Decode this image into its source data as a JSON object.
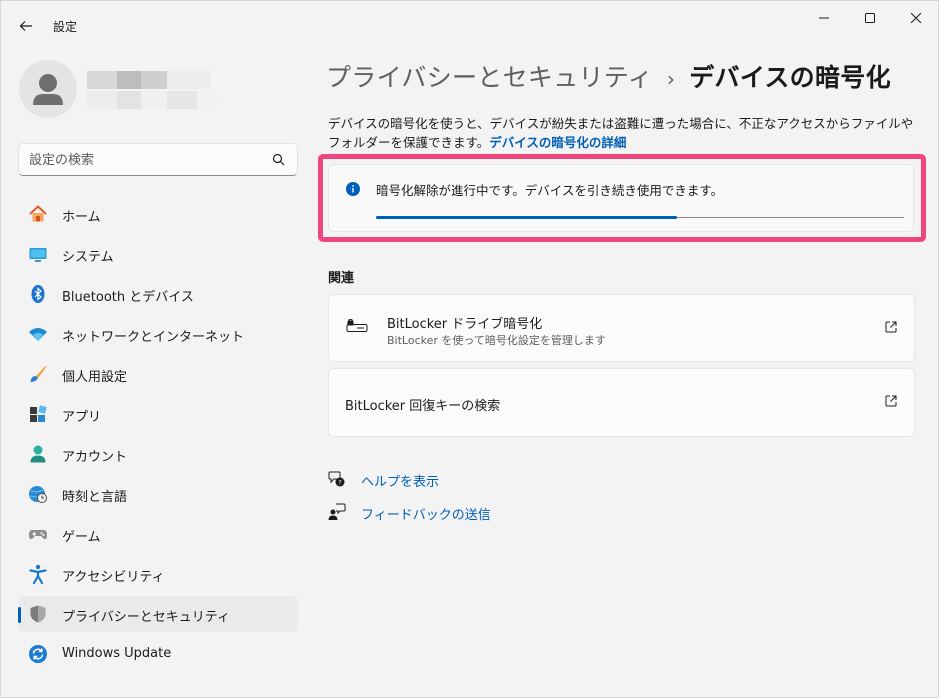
{
  "window": {
    "title": "設定"
  },
  "search": {
    "placeholder": "設定の検索"
  },
  "sidebar": {
    "items": [
      {
        "label": "ホーム",
        "icon": "home-icon"
      },
      {
        "label": "システム",
        "icon": "monitor-icon"
      },
      {
        "label": "Bluetooth とデバイス",
        "icon": "bluetooth-icon"
      },
      {
        "label": "ネットワークとインターネット",
        "icon": "wifi-icon"
      },
      {
        "label": "個人用設定",
        "icon": "brush-icon"
      },
      {
        "label": "アプリ",
        "icon": "apps-icon"
      },
      {
        "label": "アカウント",
        "icon": "person-icon"
      },
      {
        "label": "時刻と言語",
        "icon": "clock-globe-icon"
      },
      {
        "label": "ゲーム",
        "icon": "gamepad-icon"
      },
      {
        "label": "アクセシビリティ",
        "icon": "accessibility-icon"
      },
      {
        "label": "プライバシーとセキュリティ",
        "icon": "shield-icon",
        "selected": true
      },
      {
        "label": "Windows Update",
        "icon": "update-icon"
      }
    ]
  },
  "main": {
    "breadcrumb_parent": "プライバシーとセキュリティ",
    "breadcrumb_sep": "›",
    "breadcrumb_current": "デバイスの暗号化",
    "description": "デバイスの暗号化を使うと、デバイスが紛失または盗難に遭った場合に、不正なアクセスからファイルやフォルダーを保護できます。",
    "description_link": "デバイスの暗号化の詳細",
    "info": {
      "text": "暗号化解除が進行中です。デバイスを引き続き使用できます。",
      "progress_fraction": 0.57
    },
    "related_title": "関連",
    "related": [
      {
        "title": "BitLocker ドライブ暗号化",
        "subtitle": "BitLocker を使って暗号化設定を管理します"
      },
      {
        "title": "BitLocker 回復キーの検索"
      }
    ],
    "help_link": "ヘルプを表示",
    "feedback_link": "フィードバックの送信"
  },
  "colors": {
    "accent": "#005fb8",
    "highlight": "#f0467e"
  }
}
